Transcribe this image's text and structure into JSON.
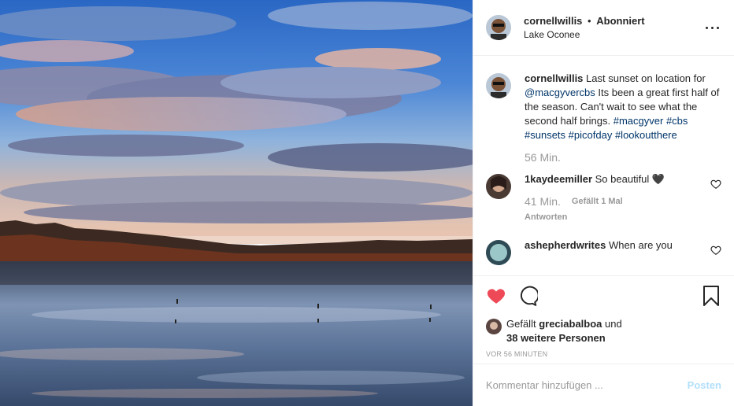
{
  "post": {
    "username": "cornellwillis",
    "separator": "•",
    "follow_label": "Abonniert",
    "location": "Lake Oconee"
  },
  "caption": {
    "username": "cornellwillis",
    "text_before": "Last sunset on location for",
    "mention": "@macgyvercbs",
    "text_after": "Its been a great first half of the season. Can't wait to see what the second half brings.",
    "hashtags": [
      "#macgyver",
      "#cbs",
      "#sunsets",
      "#picofday",
      "#lookoutthere"
    ],
    "time": "56 Min."
  },
  "comments": [
    {
      "username": "1kaydeemiller",
      "text": "So beautiful 🖤",
      "time": "41 Min.",
      "likes": "Gefällt 1 Mal",
      "reply": "Antworten"
    },
    {
      "username": "ashepherdwrites",
      "text": "When are you"
    }
  ],
  "likes": {
    "prefix": "Gefällt",
    "user": "greciabalboa",
    "middle": "und",
    "others": "38 weitere Personen"
  },
  "timestamp": "VOR 56 MINUTEN",
  "comment_input": {
    "placeholder": "Kommentar hinzufügen ...",
    "post_label": "Posten"
  },
  "colors": {
    "like_red": "#ed4956",
    "link_blue": "#003569",
    "post_disabled": "#b2dffc"
  },
  "icons": [
    "heart-icon",
    "comment-icon",
    "bookmark-icon",
    "more-icon",
    "small-heart-icon"
  ]
}
